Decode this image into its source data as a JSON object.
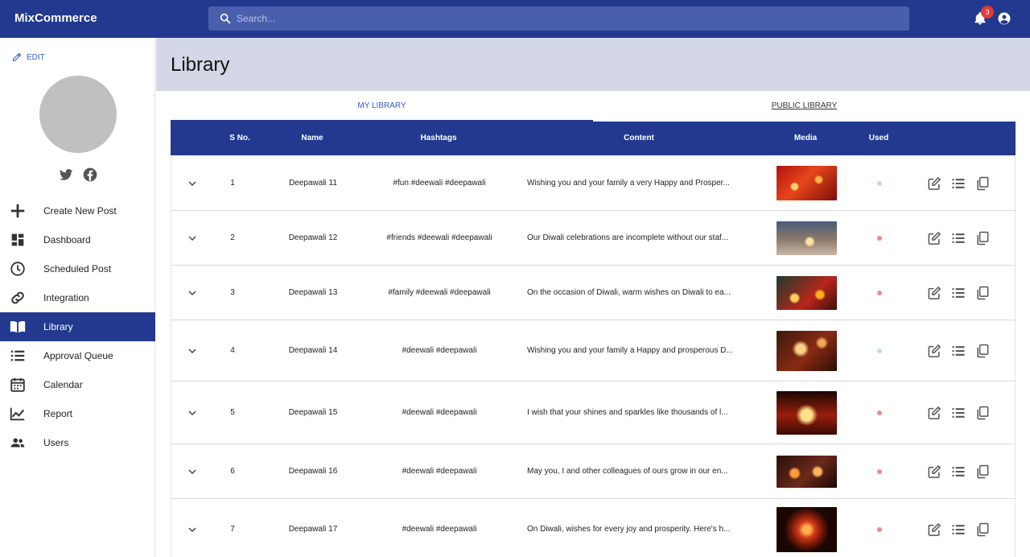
{
  "app": {
    "brand": "MixCommerce",
    "notification_count": "3"
  },
  "search": {
    "placeholder": "Search..."
  },
  "sidebar": {
    "edit_label": "EDIT",
    "items": [
      {
        "label": "Create New Post",
        "icon": "plus-icon"
      },
      {
        "label": "Dashboard",
        "icon": "dashboard-icon"
      },
      {
        "label": "Scheduled Post",
        "icon": "clock-icon"
      },
      {
        "label": "Integration",
        "icon": "link-icon"
      },
      {
        "label": "Library",
        "icon": "book-icon",
        "active": true
      },
      {
        "label": "Approval Queue",
        "icon": "list-icon"
      },
      {
        "label": "Calendar",
        "icon": "calendar-icon"
      },
      {
        "label": "Report",
        "icon": "chart-icon"
      },
      {
        "label": "Users",
        "icon": "users-icon"
      }
    ]
  },
  "page": {
    "title": "Library"
  },
  "tabs": {
    "my_library": "MY LIBRARY",
    "public_library": "PUBLIC LIBRARY"
  },
  "table": {
    "headers": {
      "sno": "S No.",
      "name": "Name",
      "hashtags": "Hashtags",
      "content": "Content",
      "media": "Media",
      "used": "Used"
    },
    "rows": [
      {
        "sno": "1",
        "name": "Deepawali 11",
        "hashtags": "#fun #deewali #deepawali",
        "content": "Wishing you and your family a very Happy and Prosper...",
        "used": "green"
      },
      {
        "sno": "2",
        "name": "Deepawali 12",
        "hashtags": "#friends #deewali #deepawali",
        "content": "Our Diwali celebrations are incomplete without our staf...",
        "used": "red"
      },
      {
        "sno": "3",
        "name": "Deepawali 13",
        "hashtags": "#family #deewali #deepawali",
        "content": "On the occasion of Diwali, warm wishes on Diwali to ea...",
        "used": "red"
      },
      {
        "sno": "4",
        "name": "Deepawali 14",
        "hashtags": "#deewali #deepawali",
        "content": "Wishing you and your family a Happy and prosperous D...",
        "used": "green"
      },
      {
        "sno": "5",
        "name": "Deepawali 15",
        "hashtags": "#deewali #deepawali",
        "content": "I wish that your shines and sparkles like thousands of l...",
        "used": "red"
      },
      {
        "sno": "6",
        "name": "Deepawali 16",
        "hashtags": "#deewali #deepawali",
        "content": "May you, I and other colleagues of ours grow in our en...",
        "used": "red"
      },
      {
        "sno": "7",
        "name": "Deepawali 17",
        "hashtags": "#deewali #deepawali",
        "content": "On Diwali, wishes for every joy and prosperity. Here's h...",
        "used": "red"
      }
    ]
  },
  "colors": {
    "primary": "#22398f",
    "used_green": "#b9e8b9",
    "used_red": "#f08a8a",
    "accent_blue": "#2f5fc5"
  }
}
